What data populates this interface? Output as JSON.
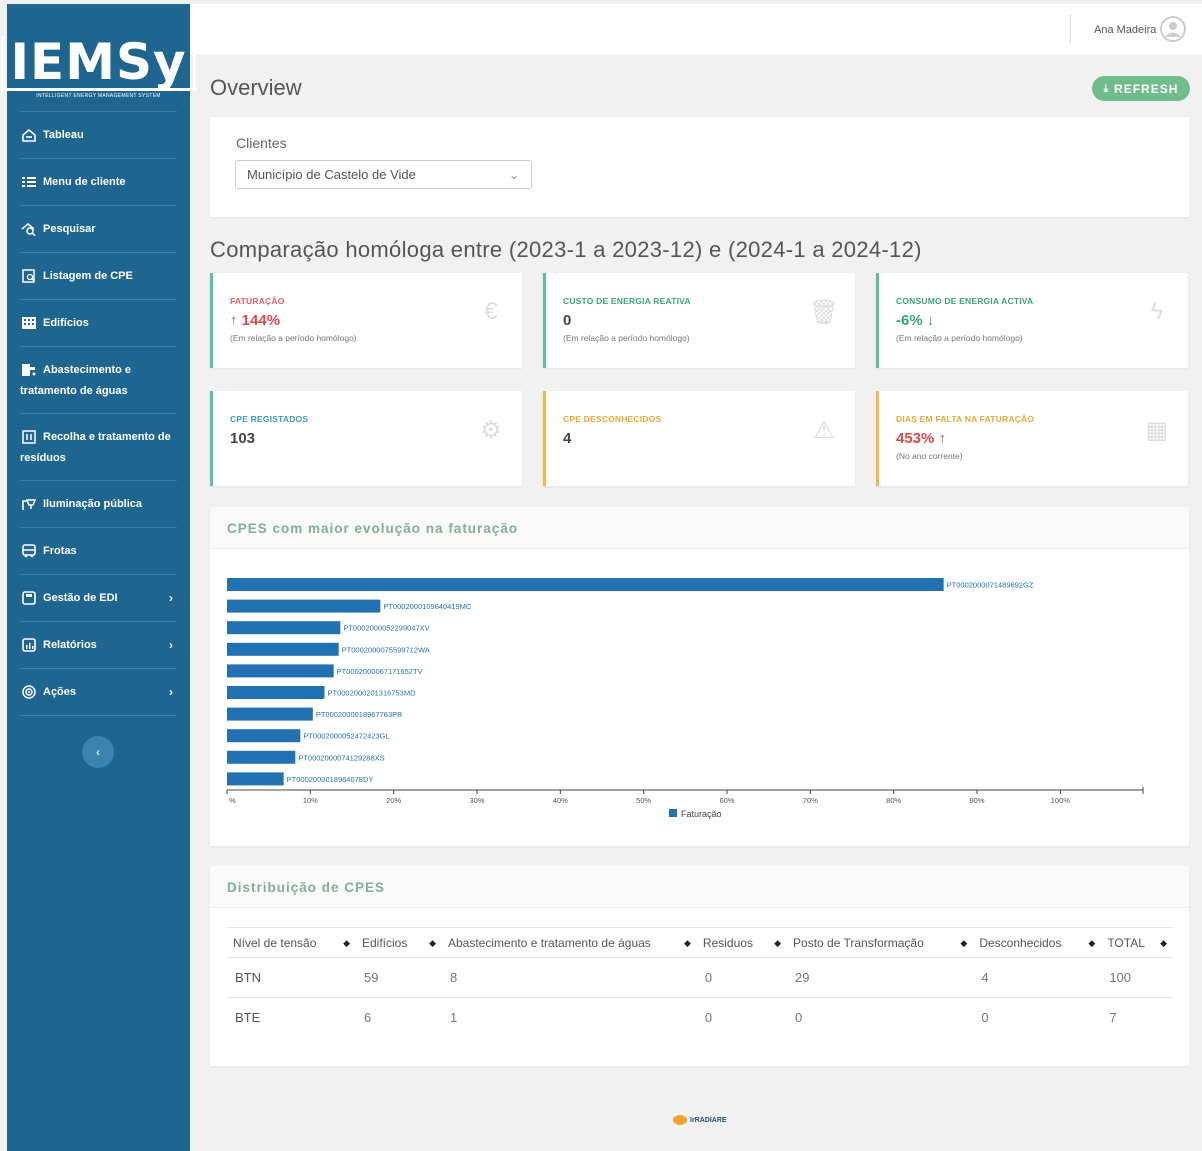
{
  "brand": {
    "name": "IEMSy",
    "tagline": "INTELLIGENT ENERGY MANAGEMENT SYSTEM"
  },
  "sidebar": {
    "items": [
      {
        "label": "Tableau",
        "icon": "dashboard-icon"
      },
      {
        "label": "Menu de cliente",
        "icon": "list-icon"
      },
      {
        "label": "Pesquisar",
        "icon": "search-icon"
      },
      {
        "label": "Listagem de CPE",
        "icon": "document-search-icon"
      },
      {
        "label": "Edifícios",
        "icon": "building-icon"
      },
      {
        "label": "Abastecimento e tratamento de águas",
        "icon": "water-tap-icon"
      },
      {
        "label": "Recolha e tratamento de resíduos",
        "icon": "trash-icon"
      },
      {
        "label": "Iluminação pública",
        "icon": "street-light-icon"
      },
      {
        "label": "Frotas",
        "icon": "bus-icon"
      },
      {
        "label": "Gestão de EDI",
        "icon": "save-icon",
        "chevron": "›"
      },
      {
        "label": "Relatórios",
        "icon": "report-icon",
        "chevron": "›"
      },
      {
        "label": "Ações",
        "icon": "target-icon",
        "chevron": "›"
      }
    ],
    "collapse_glyph": "‹"
  },
  "topbar": {
    "user_name": "Ana Madeira"
  },
  "page": {
    "title": "Overview",
    "refresh_label": "REFRESH"
  },
  "clients": {
    "label": "Clientes",
    "selected": "Município de Castelo de Vide",
    "chevron": "⌄"
  },
  "comparison_title": "Comparação homóloga entre (2023-1 a 2023-12) e (2024-1 a 2024-12)",
  "stats": [
    {
      "label": "FATURAÇÃO",
      "value": "↑ 144%",
      "note": "(Em relação a período homólogo)",
      "icon": "euro-icon",
      "glyph": "€",
      "accent": "#5bc0b0",
      "label_color": "#e06262",
      "value_color": "#e04848"
    },
    {
      "label": "CUSTO DE ENERGIA REATIVA",
      "value": "0",
      "note": "(Em relação a período homólogo)",
      "icon": "trash-icon",
      "glyph": "🗑",
      "accent": "#5bc09a",
      "label_color": "#3aa574",
      "value_color": "#444"
    },
    {
      "label": "CONSUMO DE ENERGIA ACTIVA",
      "value": "-6% ↓",
      "note": "(Em relação a período homólogo)",
      "icon": "lightning-icon",
      "glyph": "ϟ",
      "accent": "#5bc09a",
      "label_color": "#3aa574",
      "value_color": "#3aa574"
    },
    {
      "label": "CPE REGISTADOS",
      "value": "103",
      "note": "",
      "icon": "gears-icon",
      "glyph": "⚙",
      "accent": "#5bc0b0",
      "label_color": "#3a9dab",
      "value_color": "#444"
    },
    {
      "label": "CPE DESCONHECIDOS",
      "value": "4",
      "note": "",
      "icon": "warning-icon",
      "glyph": "⚠",
      "accent": "#f0b94a",
      "label_color": "#e7a93a",
      "value_color": "#444"
    },
    {
      "label": "DIAS EM FALTA NA FATURAÇÃO",
      "value": "453% ↑",
      "note": "(No ano corrente)",
      "icon": "calendar-icon",
      "glyph": "▦",
      "accent": "#f0b94a",
      "label_color": "#e7a93a",
      "value_color": "#e04848"
    }
  ],
  "chart_panel": {
    "title": "CPES com maior evolução na faturação"
  },
  "chart_data": {
    "type": "bar",
    "orientation": "horizontal",
    "categories": [
      "PT0002000071489692GZ",
      "PT0002000109640419MC",
      "PT0002000052299047XV",
      "PT0002000075599712WA",
      "PT0002000067171652TV",
      "PT0002000201316753MD",
      "PT0002000018967763PB",
      "PT0002000052472423GL",
      "PT0002000074129288XS",
      "PT0002000018964078DY"
    ],
    "series": [
      {
        "name": "Faturação",
        "values": [
          86,
          18.4,
          13.6,
          13.4,
          12.8,
          11.7,
          10.3,
          8.8,
          8.2,
          6.8
        ]
      }
    ],
    "xlim": [
      0,
      105
    ],
    "x_ticks": [
      "%",
      "10%",
      "20%",
      "30%",
      "40%",
      "50%",
      "60%",
      "70%",
      "80%",
      "90%",
      "100%"
    ],
    "legend": "bottom",
    "color": "#2271b3"
  },
  "table_panel": {
    "title": "Distribuição de CPES"
  },
  "table": {
    "headers": [
      "Nível de tensão",
      "Edifícios",
      "Abastecimento e tratamento de águas",
      "Residuos",
      "Posto de Transformação",
      "Desconhecidos",
      "TOTAL"
    ],
    "rows": [
      [
        "BTN",
        "59",
        "8",
        "0",
        "29",
        "4",
        "100"
      ],
      [
        "BTE",
        "6",
        "1",
        "0",
        "0",
        "0",
        "7"
      ]
    ]
  },
  "footer": {
    "brand": "IrRADIARE"
  }
}
